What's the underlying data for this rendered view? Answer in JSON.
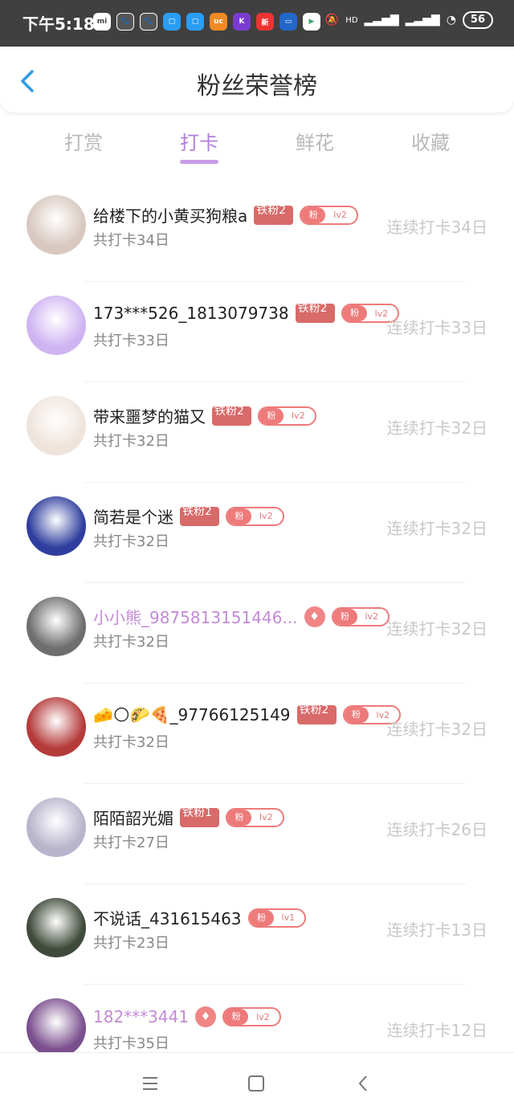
{
  "status_bar": {
    "time": "下午5:18",
    "battery": "56",
    "hd": "HD"
  },
  "header": {
    "title": "粉丝荣誉榜"
  },
  "tabs": [
    {
      "label": "打赏"
    },
    {
      "label": "打卡"
    },
    {
      "label": "鲜花"
    },
    {
      "label": "收藏"
    }
  ],
  "active_tab": "打卡",
  "badge_fan_label": "粉",
  "users": [
    {
      "name": "给楼下的小黄买狗粮a",
      "iron": "铁粉2",
      "level": "lv2",
      "total": "共打卡34日",
      "streak": "连续打卡34日",
      "avatar_color": "#d8c8c0"
    },
    {
      "name": "173***526_1813079738",
      "iron": "铁粉2",
      "level": "lv2",
      "total": "共打卡33日",
      "streak": "连续打卡33日",
      "avatar_color": "#cfb4f2"
    },
    {
      "name": "带来噩梦的猫又",
      "iron": "铁粉2",
      "level": "lv2",
      "total": "共打卡32日",
      "streak": "连续打卡32日",
      "avatar_color": "#efe4dc"
    },
    {
      "name": "简若是个迷",
      "iron": "铁粉2",
      "level": "lv2",
      "total": "共打卡32日",
      "streak": "连续打卡32日",
      "avatar_color": "#2f3e9e"
    },
    {
      "name": "小小熊_9875813151446...",
      "iron": "",
      "level": "lv2",
      "total": "共打卡32日",
      "streak": "连续打卡32日",
      "avatar_color": "#6e6e6e",
      "vip": true
    },
    {
      "name": "🧀🌕🌮🍕_97766125149",
      "iron": "铁粉2",
      "level": "lv2",
      "total": "共打卡32日",
      "streak": "连续打卡32日",
      "avatar_color": "#b53a3a"
    },
    {
      "name": "陌陌韶光媚",
      "iron": "铁粉1",
      "level": "lv2",
      "total": "共打卡27日",
      "streak": "连续打卡26日",
      "avatar_color": "#b8b4cc"
    },
    {
      "name": "不说话_431615463",
      "iron": "",
      "level": "lv1",
      "total": "共打卡23日",
      "streak": "连续打卡13日",
      "avatar_color": "#3f4a3a"
    },
    {
      "name": "182***3441",
      "iron": "",
      "level": "lv2",
      "total": "共打卡35日",
      "streak": "连续打卡12日",
      "avatar_color": "#7a4f8e",
      "vip": true
    }
  ]
}
